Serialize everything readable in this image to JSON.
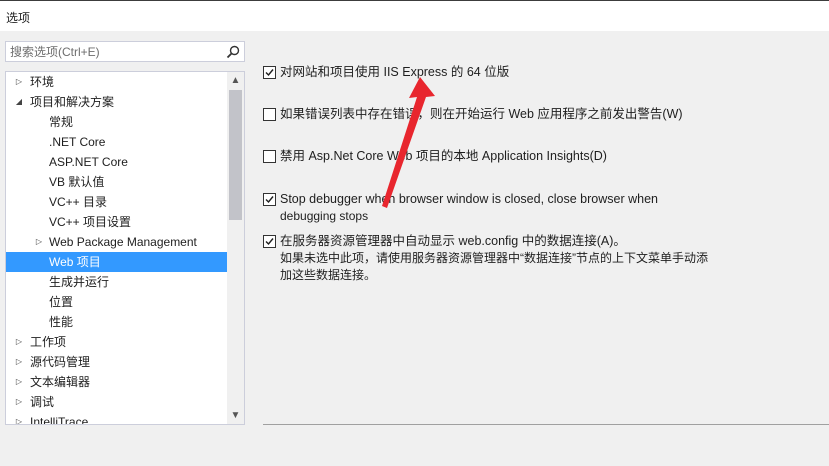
{
  "window": {
    "title": "选项"
  },
  "search": {
    "placeholder": "搜索选项(Ctrl+E)",
    "value": "",
    "icon": "search-icon"
  },
  "tree": {
    "items": [
      {
        "label": "环境",
        "level": 0,
        "expander": "collapsed"
      },
      {
        "label": "项目和解决方案",
        "level": 0,
        "expander": "expanded"
      },
      {
        "label": "常规",
        "level": 1,
        "expander": "none"
      },
      {
        "label": ".NET Core",
        "level": 1,
        "expander": "none"
      },
      {
        "label": "ASP.NET Core",
        "level": 1,
        "expander": "none"
      },
      {
        "label": "VB 默认值",
        "level": 1,
        "expander": "none"
      },
      {
        "label": "VC++ 目录",
        "level": 1,
        "expander": "none"
      },
      {
        "label": "VC++ 项目设置",
        "level": 1,
        "expander": "none"
      },
      {
        "label": "Web Package Management",
        "level": 1,
        "expander": "collapsed"
      },
      {
        "label": "Web 项目",
        "level": 1,
        "expander": "none",
        "selected": true
      },
      {
        "label": "生成并运行",
        "level": 1,
        "expander": "none"
      },
      {
        "label": "位置",
        "level": 1,
        "expander": "none"
      },
      {
        "label": "性能",
        "level": 1,
        "expander": "none"
      },
      {
        "label": "工作项",
        "level": 0,
        "expander": "collapsed"
      },
      {
        "label": "源代码管理",
        "level": 0,
        "expander": "collapsed"
      },
      {
        "label": "文本编辑器",
        "level": 0,
        "expander": "collapsed"
      },
      {
        "label": "调试",
        "level": 0,
        "expander": "collapsed"
      },
      {
        "label": "IntelliTrace",
        "level": 0,
        "expander": "collapsed"
      }
    ]
  },
  "options": {
    "iis_express_64": {
      "label": "对网站和项目使用 IIS Express 的 64 位版",
      "checked": true
    },
    "warn_errors": {
      "label": "如果错误列表中存在错误，则在开始运行 Web 应用程序之前发出警告(W)",
      "checked": false
    },
    "disable_insights": {
      "label": "禁用 Asp.Net Core Web 项目的本地 Application Insights(D)",
      "checked": false
    },
    "stop_debugger": {
      "label_line1": "Stop debugger when browser window is closed, close browser when",
      "label_line2": "debugging stops",
      "checked": true
    },
    "auto_show_connections": {
      "label": "在服务器资源管理器中自动显示 web.config 中的数据连接(A)。",
      "note_line1": "如果未选中此项，请使用服务器资源管理器中“数据连接”节点的上下文菜单手动添",
      "note_line2": "加这些数据连接。",
      "checked": true
    }
  },
  "colors": {
    "selection": "#3399ff",
    "annotation": "#e8262e"
  }
}
